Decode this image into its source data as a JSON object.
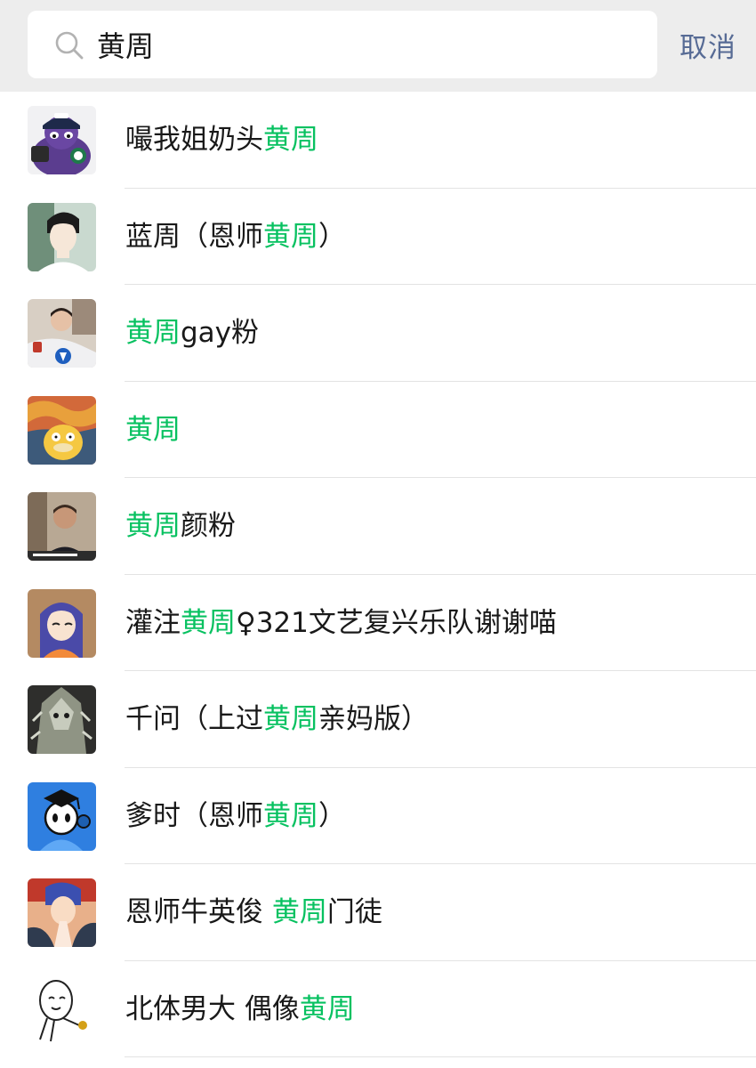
{
  "search": {
    "query": "黄周",
    "cancel_label": "取消",
    "icon": "search-icon"
  },
  "colors": {
    "highlight": "#07c160",
    "cancel": "#576b95",
    "text": "#191919",
    "header_bg": "#ededed"
  },
  "results": [
    {
      "parts": [
        "嘬我姐奶头",
        "黄周"
      ],
      "hl": [
        false,
        true
      ],
      "avatar": "purple-character-avatar"
    },
    {
      "parts": [
        "蓝周（恩师",
        "黄周",
        "）"
      ],
      "hl": [
        false,
        true,
        false
      ],
      "avatar": "anime-boy-avatar"
    },
    {
      "parts": [
        "黄周",
        "gay粉"
      ],
      "hl": [
        true,
        false
      ],
      "avatar": "person-photo-avatar"
    },
    {
      "parts": [
        "黄周"
      ],
      "hl": [
        true
      ],
      "avatar": "psyduck-scream-avatar"
    },
    {
      "parts": [
        "黄周",
        "颜粉"
      ],
      "hl": [
        true,
        false
      ],
      "avatar": "man-photo-avatar"
    },
    {
      "parts": [
        "灌注",
        "黄周",
        "♀321文艺复兴乐队谢谢喵"
      ],
      "hl": [
        false,
        true,
        false
      ],
      "avatar": "anime-girl-avatar"
    },
    {
      "parts": [
        "千问（上过",
        "黄周",
        "亲妈版）"
      ],
      "hl": [
        false,
        true,
        false
      ],
      "avatar": "armored-figure-avatar"
    },
    {
      "parts": [
        "爹时（恩师",
        "黄周",
        "）"
      ],
      "hl": [
        false,
        true,
        false
      ],
      "avatar": "cartoon-graduate-avatar"
    },
    {
      "parts": [
        "恩师牛英俊 ",
        "黄周",
        "门徒"
      ],
      "hl": [
        false,
        true,
        false
      ],
      "avatar": "anime-praying-avatar"
    },
    {
      "parts": [
        "北体男大 偶像",
        "黄周"
      ],
      "hl": [
        false,
        true
      ],
      "avatar": "doodle-face-avatar"
    }
  ]
}
